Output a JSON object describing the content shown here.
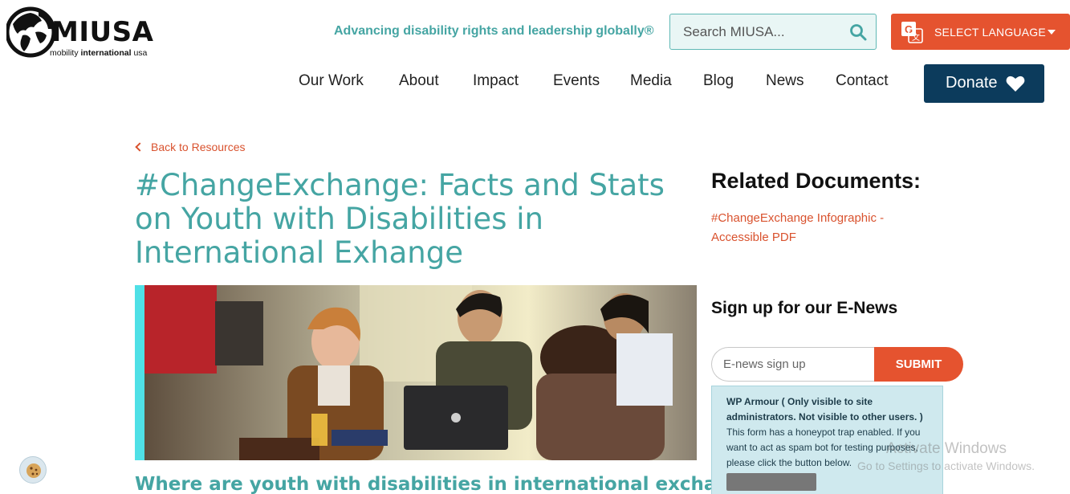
{
  "header": {
    "logo_text": "MIUSA",
    "logo_sub_normal": "mobility ",
    "logo_sub_bold": "international",
    "logo_sub_end": " usa",
    "tagline": "Advancing disability rights and leadership globally®",
    "search_placeholder": "Search MIUSA...",
    "language_label": "SELECT LANGUAGE",
    "donate_label": "Donate"
  },
  "nav": {
    "items": [
      {
        "label": "Our Work"
      },
      {
        "label": "About"
      },
      {
        "label": "Impact"
      },
      {
        "label": "Events"
      },
      {
        "label": "Media"
      },
      {
        "label": "Blog"
      },
      {
        "label": "News"
      },
      {
        "label": "Contact"
      }
    ]
  },
  "main": {
    "back_label": "Back to Resources",
    "title": "#ChangeExchange: Facts and Stats on Youth with Disabilities in International Exhange",
    "subheading": "Where are youth with disabilities in international exchange?"
  },
  "sidebar": {
    "related_heading": "Related Documents:",
    "related_link": "#ChangeExchange Infographic - Accessible PDF",
    "enews_heading": "Sign up for our E-News",
    "enews_placeholder": "E-news sign up",
    "submit_label": "SUBMIT",
    "wp_title": "WP Armour ( Only visible to site administrators. Not visible to other users. )",
    "wp_text": "This form has a honeypot trap enabled. If you want to act as spam bot for testing purposes, please click the button below."
  },
  "watermark": {
    "line1": "Activate Windows",
    "line2": "Go to Settings to activate Windows."
  },
  "icons": {
    "search": "search-icon",
    "language": "google-translate-icon",
    "donate": "heart-icon",
    "back": "chevron-left-icon",
    "cookie": "cookie-icon"
  },
  "colors": {
    "teal": "#45a5a3",
    "orange": "#e5532f",
    "navy": "#0c3b5c",
    "accent_cyan": "#4fe0e6"
  }
}
